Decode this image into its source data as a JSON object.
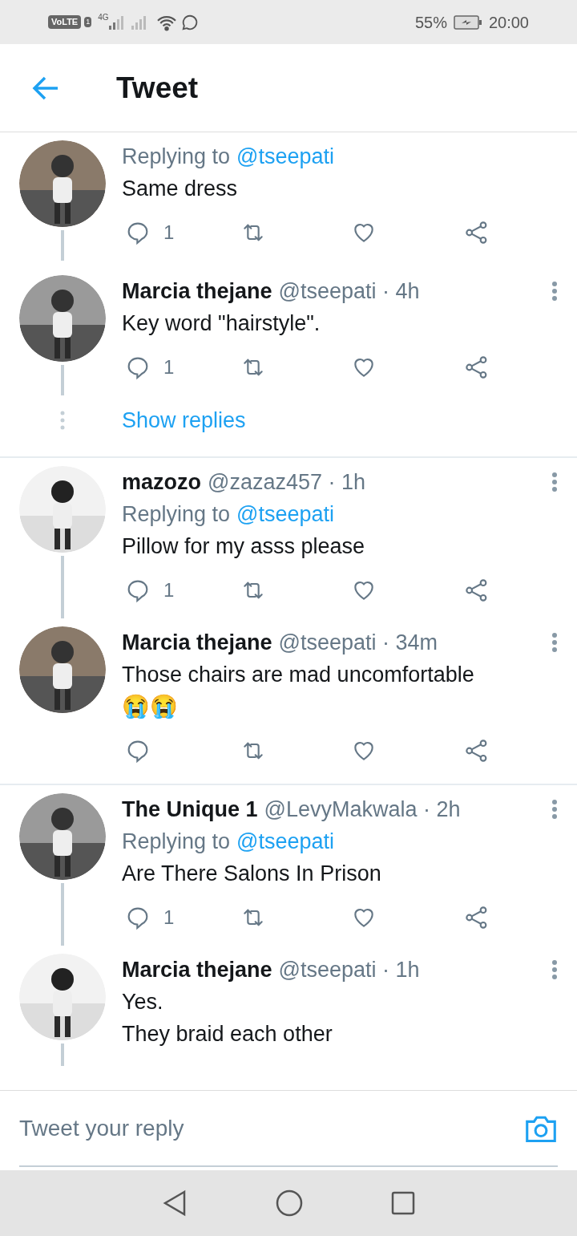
{
  "status_bar": {
    "network": "VoLTE",
    "sim": "1",
    "signal": "4G",
    "battery": "55%",
    "time": "20:00"
  },
  "header": {
    "title": "Tweet"
  },
  "threads": [
    {
      "tweets": [
        {
          "replying_to_label": "Replying to",
          "replying_to": "@tseepati",
          "text": "Same dress",
          "reply_count": "1",
          "actions": true,
          "thread_line": true
        },
        {
          "name": "Marcia thejane",
          "meta": "@tseepati · 4h",
          "text": "Key word \"hairstyle\".",
          "reply_count": "1",
          "actions": true,
          "thread_line": true
        }
      ],
      "show_replies": "Show replies"
    },
    {
      "tweets": [
        {
          "name": "mazozo",
          "meta": "@zazaz457 · 1h",
          "replying_to_label": "Replying to",
          "replying_to": "@tseepati",
          "text": "Pillow for my asss please",
          "reply_count": "1",
          "actions": true,
          "thread_line": true
        },
        {
          "name": "Marcia thejane",
          "meta": "@tseepati · 34m",
          "text": "Those chairs are mad uncomfortable",
          "emoji": "😭😭",
          "actions": true,
          "thread_line": false
        }
      ]
    },
    {
      "tweets": [
        {
          "name": "The Unique 1",
          "meta": "@LevyMakwala · 2h",
          "replying_to_label": "Replying to",
          "replying_to": "@tseepati",
          "text": "Are There Salons In Prison",
          "reply_count": "1",
          "actions": true,
          "thread_line": true
        },
        {
          "name": "Marcia thejane",
          "meta": "@tseepati · 1h",
          "text": "Yes.\nThey braid each other",
          "actions": false,
          "thread_line": true
        }
      ]
    }
  ],
  "reply_bar": {
    "placeholder": "Tweet your reply"
  }
}
